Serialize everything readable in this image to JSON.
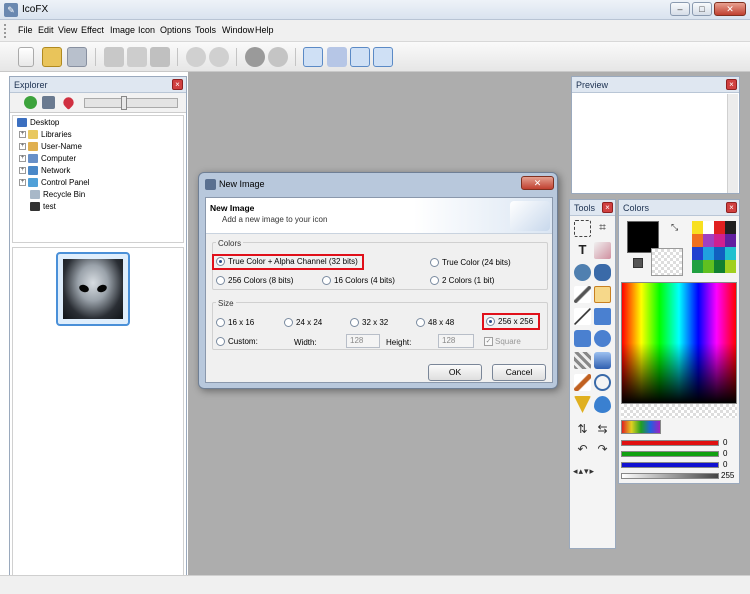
{
  "app": {
    "title": "IcoFX"
  },
  "menu": [
    "File",
    "Edit",
    "View",
    "Effect",
    "Image",
    "Icon",
    "Options",
    "Tools",
    "Window",
    "Help"
  ],
  "explorer": {
    "title": "Explorer",
    "tree": [
      {
        "label": "Desktop",
        "indent": 0,
        "expand": ""
      },
      {
        "label": "Libraries",
        "indent": 1,
        "expand": "+"
      },
      {
        "label": "User-Name",
        "indent": 1,
        "expand": "+"
      },
      {
        "label": "Computer",
        "indent": 1,
        "expand": "+"
      },
      {
        "label": "Network",
        "indent": 1,
        "expand": "+"
      },
      {
        "label": "Control Panel",
        "indent": 1,
        "expand": "+"
      },
      {
        "label": "Recycle Bin",
        "indent": 1,
        "expand": ""
      },
      {
        "label": "test",
        "indent": 1,
        "expand": ""
      }
    ]
  },
  "preview": {
    "title": "Preview"
  },
  "tools": {
    "title": "Tools"
  },
  "colors": {
    "title": "Colors",
    "slider_values": [
      "0",
      "0",
      "0",
      "255"
    ],
    "channel_colors": [
      "#e01010",
      "#10a010",
      "#1010d0",
      "#888888"
    ]
  },
  "dialog": {
    "title": "New Image",
    "header_title": "New Image",
    "header_subtitle": "Add a new image to your icon",
    "colors_group": "Colors",
    "color_options": [
      "True Color + Alpha Channel (32 bits)",
      "True Color (24 bits)",
      "256 Colors (8 bits)",
      "16 Colors (4 bits)",
      "2 Colors (1 bit)"
    ],
    "size_group": "Size",
    "size_options": [
      "16 x 16",
      "24 x 24",
      "32 x 32",
      "48 x 48",
      "256 x 256"
    ],
    "custom_label": "Custom:",
    "width_label": "Width:",
    "width_value": "128",
    "height_label": "Height:",
    "height_value": "128",
    "square_label": "Square",
    "ok_label": "OK",
    "cancel_label": "Cancel"
  }
}
